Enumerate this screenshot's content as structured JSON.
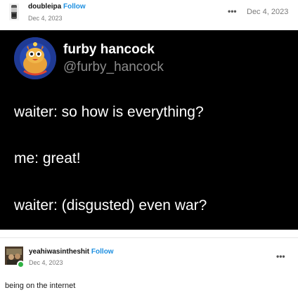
{
  "post1": {
    "username": "doubleipa",
    "follow_label": "Follow",
    "date": "Dec 4, 2023",
    "right_date": "Dec 4, 2023",
    "more_icon": "ellipsis-icon"
  },
  "tweet": {
    "name": "furby hancock",
    "handle": "@furby_hancock",
    "lines": [
      "waiter: so how is everything?",
      "me: great!",
      "waiter: (disgusted) even war?"
    ]
  },
  "post2": {
    "username": "yeahiwasintheshit",
    "follow_label": "Follow",
    "date": "Dec 4, 2023",
    "more_icon": "ellipsis-icon",
    "caption": "being on the internet"
  },
  "colors": {
    "follow": "#1d8fe0",
    "tweet_bg": "#000000",
    "online_badge": "#2fb344"
  }
}
